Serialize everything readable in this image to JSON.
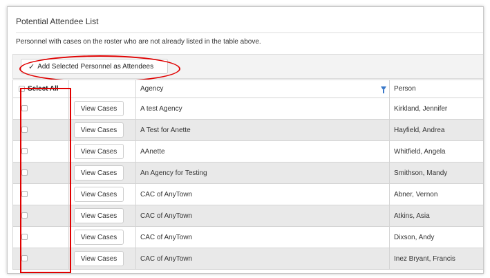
{
  "panel": {
    "title": "Potential Attendee List",
    "description": "Personnel with cases on the roster who are not already listed in the table above."
  },
  "toolbar": {
    "add_label": "Add Selected Personnel as Attendees",
    "add_icon": "check-icon"
  },
  "table": {
    "select_all_label": "Select All",
    "columns": [
      "",
      "",
      "Agency",
      "Person"
    ],
    "view_label": "View Cases",
    "filter_icon": "filter-icon",
    "rows": [
      {
        "agency": "A test Agency",
        "person": "Kirkland, Jennifer"
      },
      {
        "agency": "A Test for Anette",
        "person": "Hayfield, Andrea"
      },
      {
        "agency": "AAnette",
        "person": "Whitfield, Angela"
      },
      {
        "agency": "An Agency for Testing",
        "person": "Smithson, Mandy"
      },
      {
        "agency": "CAC of AnyTown",
        "person": "Abner, Vernon"
      },
      {
        "agency": "CAC of AnyTown",
        "person": "Atkins, Asia"
      },
      {
        "agency": "CAC of AnyTown",
        "person": "Dixson, Andy"
      },
      {
        "agency": "CAC of AnyTown",
        "person": "Inez Bryant, Francis"
      }
    ]
  },
  "annotations": {
    "highlight_color": "#e00000"
  }
}
